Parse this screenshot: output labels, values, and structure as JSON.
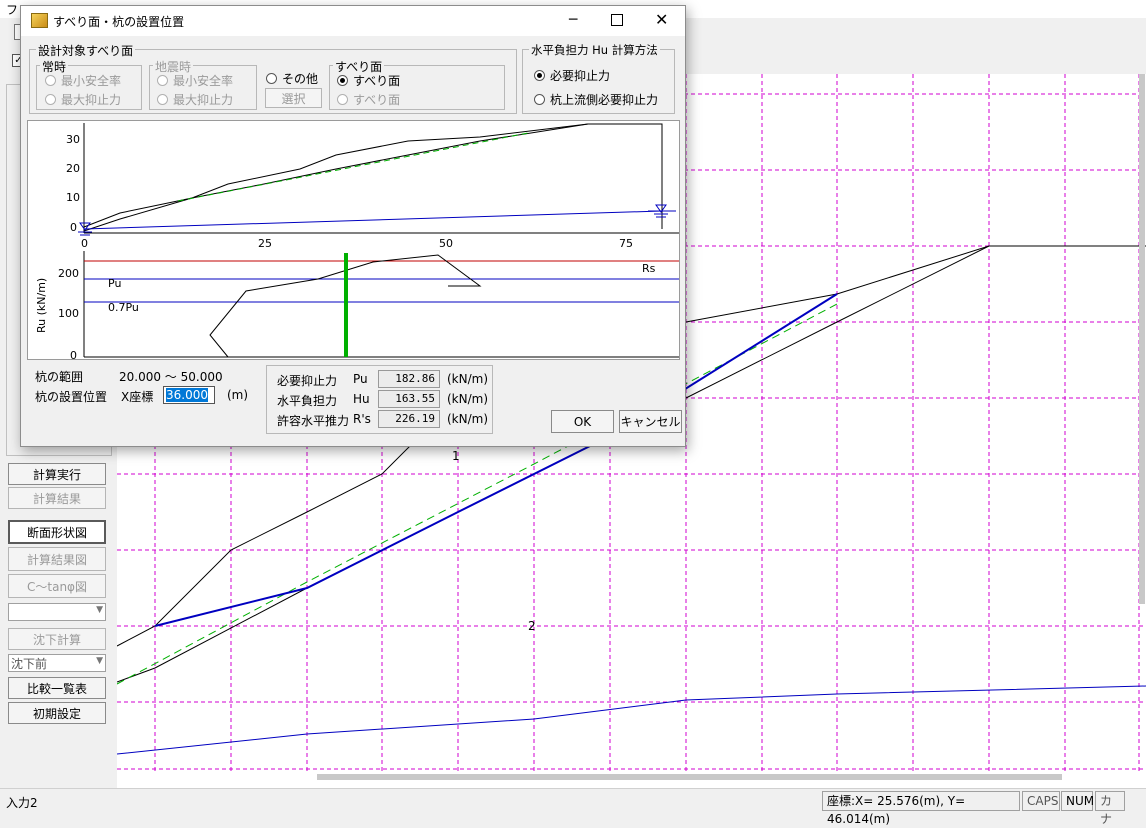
{
  "main_window": {
    "menu_initial": "フ",
    "sidebar_buttons": {
      "calc_run": "計算実行",
      "calc_result": "計算結果",
      "section_view": "断面形状図",
      "result_view": "計算結果図",
      "c_tan_view": "C〜tanφ図",
      "settle_calc": "沈下計算",
      "settle_state": "沈下前",
      "compare_table": "比較一覧表",
      "initial_setting": "初期設定"
    },
    "background_labels": {
      "slip1": "1",
      "slip2": "2"
    },
    "statusbar": {
      "left_text": "入力2",
      "coord_text": "座標:X=  25.576(m), Y=  46.014(m)",
      "caps": "CAPS",
      "num": "NUM",
      "kana": "カナ"
    }
  },
  "dialog": {
    "title": "すべり面・杭の設置位置",
    "group_target": {
      "label": "設計対象すべり面",
      "normal": {
        "label": "常時",
        "opt1": "最小安全率",
        "opt2": "最大抑止力"
      },
      "seismic": {
        "label": "地震時",
        "opt1": "最小安全率",
        "opt2": "最大抑止力"
      },
      "other": {
        "label": "その他",
        "select_button": "選択"
      },
      "slip": {
        "label": "すべり面",
        "opt1": "すべり面",
        "opt2": "すべり面"
      }
    },
    "group_method": {
      "label": "水平負担力 Hu 計算方法",
      "opt1": "必要抑止力",
      "opt2": "杭上流側必要抑止力"
    },
    "plot": {
      "y_ticks_top": [
        "30",
        "20",
        "10",
        "0"
      ],
      "x_ticks": [
        "0",
        "25",
        "50",
        "75"
      ],
      "y_ticks_bottom": [
        "200",
        "100",
        "0"
      ],
      "y_axis_label": "Ru (kN/m)",
      "line_labels": {
        "rs": "Rs",
        "pu": "Pu",
        "pu07": "0.7Pu"
      }
    },
    "pile_range_label": "杭の範囲",
    "pile_range_value": "20.000 〜 50.000",
    "pile_position_label": "杭の設置位置",
    "x_coord_label": "X座標",
    "x_coord_value": "36.000",
    "x_coord_unit": "(m)",
    "results": [
      {
        "name": "必要抑止力",
        "symbol": "Pu",
        "value": "182.86",
        "unit": "(kN/m)"
      },
      {
        "name": "水平負担力",
        "symbol": "Hu",
        "value": "163.55",
        "unit": "(kN/m)"
      },
      {
        "name": "許容水平推力",
        "symbol": "R's",
        "value": "226.19",
        "unit": "(kN/m)"
      }
    ],
    "ok_button": "OK",
    "cancel_button": "キャンセル"
  },
  "colors": {
    "grid": "#d000d0",
    "slip_line": "#0000c0",
    "critical_dashed": "#00b000",
    "pile_marker": "#00b000",
    "rs_line": "#c00000"
  }
}
